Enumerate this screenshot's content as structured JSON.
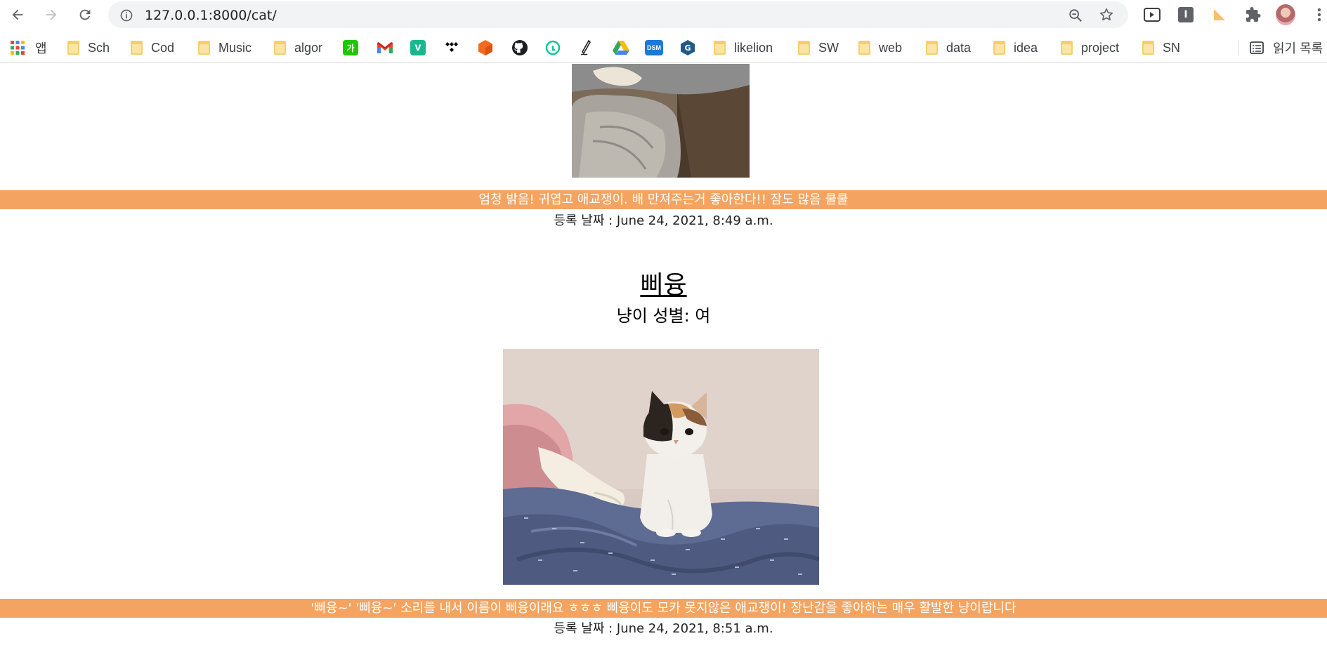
{
  "browser": {
    "url_host": "127.0.0.1",
    "url_rest": ":8000/cat/"
  },
  "bookmarks": {
    "apps_label": "앱",
    "folders": [
      "Sch",
      "Cod",
      "Music",
      "algor",
      "likelion",
      "SW",
      "web",
      "data",
      "idea",
      "project",
      "SN"
    ],
    "reading_list": "읽기 목록",
    "favicons": [
      "naver-dict-icon",
      "gmail-icon",
      "vimeo-icon",
      "tidal-icon",
      "cube-icon",
      "github-icon",
      "grammarly-icon",
      "pen-icon",
      "google-drive-icon",
      "dsm-icon",
      "g-icon"
    ],
    "dsm_label": "DSM",
    "naver_label": "가"
  },
  "posts": [
    {
      "description": "엄청 밝음! 귀엽고 애교쟁이. 배 만져주는거 좋아한다!! 잠도 많음 쿨쿨",
      "date": "등록 날짜 : June 24, 2021, 8:49 a.m."
    },
    {
      "name": "삐융",
      "gender": "냥이 성별: 여",
      "description": "'삐융~' '삐융~' 소리를 내서 이름이 삐융이래요 ㅎㅎㅎ 삐융이도 모카 못지않은 애교쟁이! 장난감을 좋아하는 매우 활발한 냥이랍니다",
      "date": "등록 날짜 : June 24, 2021, 8:51 a.m."
    }
  ],
  "colors": {
    "accent_bar": "#f4a460"
  }
}
